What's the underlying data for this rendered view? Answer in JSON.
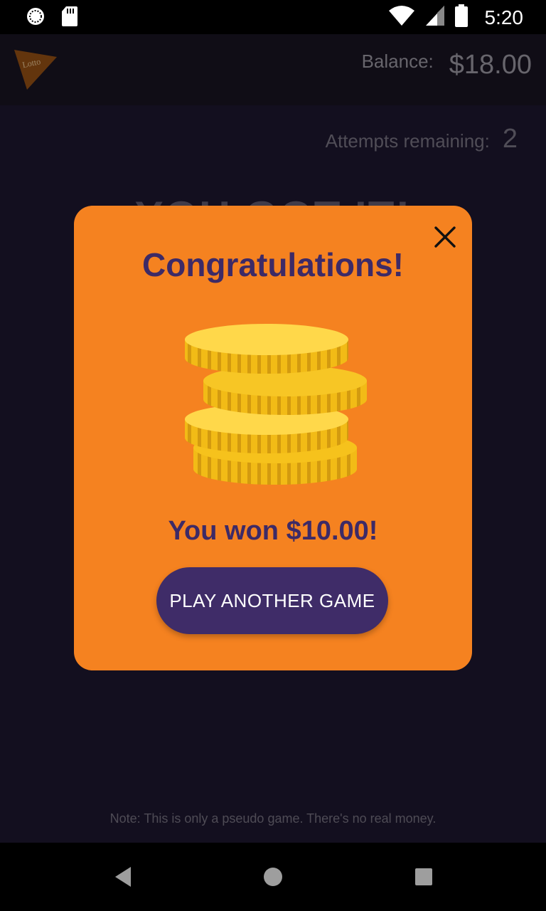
{
  "status_bar": {
    "time": "5:20",
    "icons": [
      "sync-icon",
      "sd-card-icon",
      "wifi-icon",
      "signal-icon",
      "battery-icon"
    ]
  },
  "app_bar": {
    "logo_text": "Lotto",
    "balance_label": "Balance:",
    "balance_value": "$18.00"
  },
  "game": {
    "attempts_label": "Attempts remaining:",
    "attempts_value": "2",
    "result_heading": "YOU GOT IT!",
    "note": "Note: This is only a pseudo game. There's no real money."
  },
  "dialog": {
    "title": "Congratulations!",
    "win_text": "You won $10.00!",
    "button_label": "PLAY ANOTHER GAME",
    "icons": [
      "close-icon",
      "coins-icon"
    ]
  },
  "nav_bar": {
    "icons": [
      "back-icon",
      "home-icon",
      "recents-icon"
    ]
  },
  "colors": {
    "background": "#1b152b",
    "dialog": "#f58220",
    "accent_purple": "#3d2a66",
    "coin_gold": "#f5c518"
  }
}
